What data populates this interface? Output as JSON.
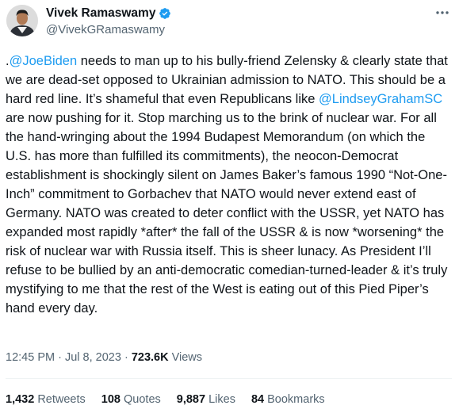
{
  "author": {
    "name": "Vivek Ramaswamy",
    "handle": "@VivekGRamaswamy"
  },
  "tweet": {
    "lead_punct": ".",
    "mention1": "@JoeBiden",
    "text1": " needs to man up to his bully-friend Zelensky & clearly state that we are dead-set opposed to Ukrainian admission to NATO. This should be a hard red line. It’s shameful that even Republicans like ",
    "mention2": "@LindseyGrahamSC",
    "text2": " are now pushing for it. Stop marching us to the brink of nuclear war. For all the hand-wringing about the 1994 Budapest Memorandum (on which the U.S. has more than fulfilled its commitments), the neocon-Democrat establishment is shockingly silent on James Baker’s famous 1990 “Not-One-Inch” commitment to Gorbachev that NATO would never extend east of Germany. NATO was created to deter conflict with the USSR, yet NATO has expanded most rapidly *after* the fall of the USSR & is now *worsening* the risk of nuclear war with Russia itself. This is sheer lunacy. As President I’ll refuse to be bullied by an anti-democratic comedian-turned-leader & it’s truly mystifying to me that the rest of the West is eating out of this Pied Piper’s hand every day."
  },
  "meta": {
    "time": "12:45 PM",
    "sep1": " · ",
    "date": "Jul 8, 2023",
    "sep2": " · ",
    "views_count": "723.6K",
    "views_label": " Views"
  },
  "stats": {
    "retweets_count": "1,432",
    "retweets_label": " Retweets",
    "quotes_count": "108",
    "quotes_label": " Quotes",
    "likes_count": "9,887",
    "likes_label": " Likes",
    "bookmarks_count": "84",
    "bookmarks_label": " Bookmarks"
  },
  "colors": {
    "link": "#1d9bf0",
    "secondary_text": "#536471",
    "primary_text": "#0f1419",
    "verified": "#1d9bf0"
  },
  "icons": {
    "verified": "verified-badge-icon",
    "more": "more-options-icon"
  }
}
